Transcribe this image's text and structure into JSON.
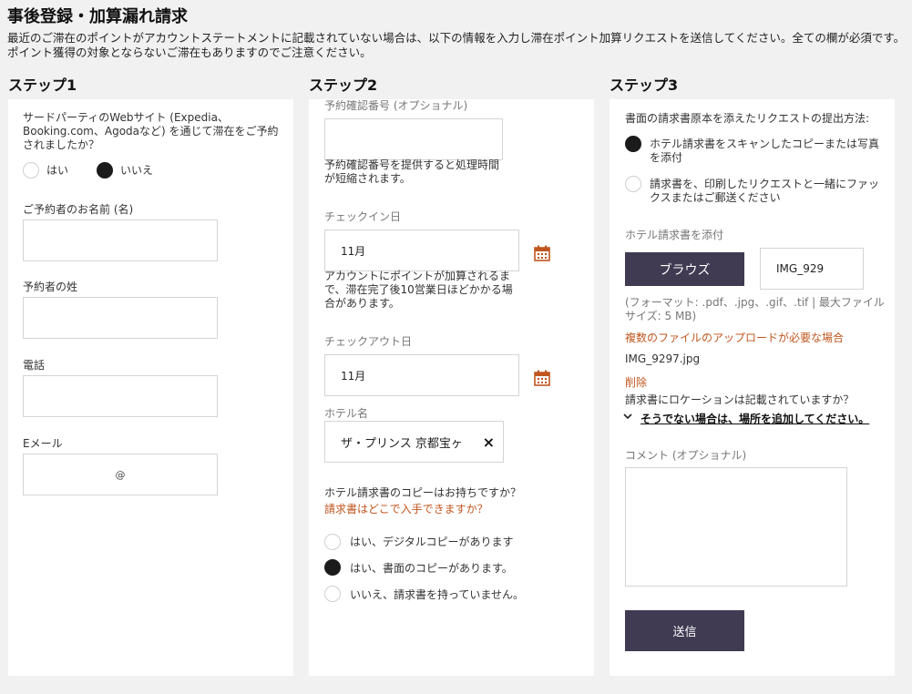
{
  "page": {
    "title": "事後登録・加算漏れ請求",
    "intro": "最近のご滞在のポイントがアカウントステートメントに記載されていない場合は、以下の情報を入力し滞在ポイント加算リクエストを送信してください。全ての欄が必須です。ポイント獲得の対象とならないご滞在もありますのでご注意ください。"
  },
  "step1": {
    "title": "ステップ1",
    "question": "サードパーティのWebサイト (Expedia、Booking.com、Agodaなど) を通じて滞在をご予約されましたか？",
    "yes_label": "はい",
    "no_label": "いいえ",
    "selected": "no",
    "first_name_label": "ご予約者のお名前 (名)",
    "first_name_value": "",
    "last_name_label": "予約者の姓",
    "last_name_value": "",
    "phone_label": "電話",
    "phone_value": "",
    "email_label": "Eメール",
    "email_value": "@"
  },
  "step2": {
    "title": "ステップ2",
    "confirmation_label": "予約確認番号 (オプショナル)",
    "confirmation_value": "",
    "confirmation_help": "予約確認番号を提供すると処理時間が短縮されます。",
    "checkin_label": "チェックイン日",
    "checkin_value": "11月",
    "checkin_help": "アカウントにポイントが加算されるまで、滞在完了後10営業日ほどかかる場合があります。",
    "checkout_label": "チェックアウト日",
    "checkout_value": "11月",
    "hotel_label": "ホテル名",
    "hotel_value": "ザ・プリンス 京都宝ヶ",
    "clear_glyph": "×",
    "invoice_question": "ホテル請求書のコピーはお持ちですか？",
    "invoice_where_link": "請求書はどこで入手できますか？",
    "options": [
      {
        "label": "はい、デジタルコピーがあります",
        "selected": false
      },
      {
        "label": "はい、書面のコピーがあります。",
        "selected": true
      },
      {
        "label": "いいえ、請求書を持っていません。",
        "selected": false
      }
    ]
  },
  "step3": {
    "title": "ステップ3",
    "method_label": "書面の請求書原本を添えたリクエストの提出方法:",
    "methods": [
      {
        "label": "ホテル請求書をスキャンしたコピーまたは写真を添付",
        "selected": true
      },
      {
        "label": "請求書を、印刷したリクエストと一緒にファックスまたはご郵送ください",
        "selected": false
      }
    ],
    "attach_label": "ホテル請求書を添付",
    "browse_label": "ブラウズ",
    "file_field_value": "IMG_929",
    "format_note": "(フォーマット: .pdf、.jpg、.gif、.tif | 最大ファイルサイズ: 5 MB)",
    "multi_upload_link": "複数のファイルのアップロードが必要な場合",
    "uploaded_file": "IMG_9297.jpg",
    "delete_link": "削除",
    "location_question": "請求書にロケーションは記載されていますか？",
    "add_location_link": "そうでない場合は、場所を追加してください。",
    "comment_label": "コメント (オプショナル)",
    "comment_value": "",
    "submit_label": "送信"
  },
  "colors": {
    "accent_orange": "#c0561f",
    "button_dark": "#403b52",
    "background": "#f1f1f1"
  }
}
